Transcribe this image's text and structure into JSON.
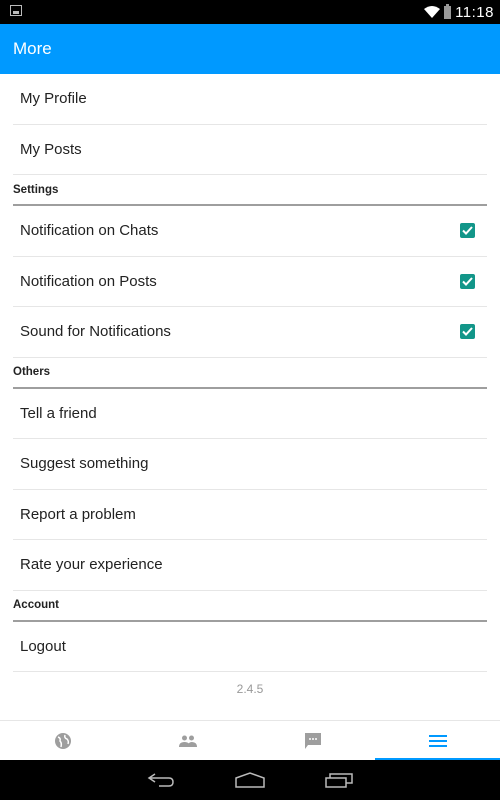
{
  "status_bar": {
    "time": "11:18",
    "icons": [
      "image-notification-icon",
      "wifi-icon",
      "battery-icon"
    ]
  },
  "app_bar": {
    "title": "More"
  },
  "top_items": [
    {
      "label": "My Profile"
    },
    {
      "label": "My Posts"
    }
  ],
  "sections": {
    "settings": {
      "title": "Settings",
      "items": [
        {
          "label": "Notification on Chats",
          "checked": true
        },
        {
          "label": "Notification on Posts",
          "checked": true
        },
        {
          "label": "Sound for Notifications",
          "checked": true
        }
      ]
    },
    "others": {
      "title": "Others",
      "items": [
        {
          "label": "Tell a friend"
        },
        {
          "label": "Suggest something"
        },
        {
          "label": "Report a problem"
        },
        {
          "label": "Rate your experience"
        }
      ]
    },
    "account": {
      "title": "Account",
      "items": [
        {
          "label": "Logout"
        }
      ]
    }
  },
  "version": "2.4.5",
  "bottom_nav": {
    "tabs": [
      {
        "icon": "globe-icon",
        "active": false
      },
      {
        "icon": "people-icon",
        "active": false
      },
      {
        "icon": "chat-icon",
        "active": false
      },
      {
        "icon": "menu-icon",
        "active": true
      }
    ]
  },
  "system_nav": {
    "buttons": [
      "back",
      "home",
      "recents"
    ]
  },
  "colors": {
    "accent": "#0099ff",
    "checkbox": "#129689"
  }
}
